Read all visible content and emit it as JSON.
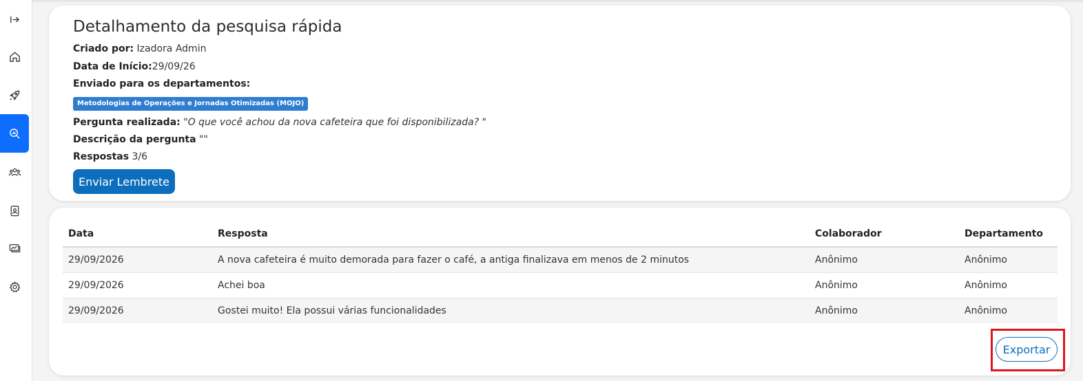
{
  "sidebar": {
    "items": [
      {
        "icon": "expand-icon"
      },
      {
        "icon": "home-icon"
      },
      {
        "icon": "rocket-icon"
      },
      {
        "icon": "search-analytics-icon",
        "active": true
      },
      {
        "icon": "team-icon"
      },
      {
        "icon": "badge-icon"
      },
      {
        "icon": "chart-card-icon"
      },
      {
        "icon": "gear-icon"
      }
    ],
    "active_color": "#0d6efd"
  },
  "detail": {
    "title": "Detalhamento da pesquisa rápida",
    "created_by_label": "Criado por:",
    "created_by_value": " Izadora Admin",
    "start_date_label": "Data de Início:",
    "start_date_value": "29/09/26",
    "departments_label": "Enviado para os departamentos:",
    "department_badge": "Metodologias de Operações e Jornadas Otimizadas (MOJO)",
    "question_label": "Pergunta realizada:",
    "question_value": " \"O que você achou da nova cafeteira que foi disponibilizada? \"",
    "description_label": "Descrição da pergunta",
    "description_value": " \"\"",
    "responses_label": "Respostas",
    "responses_value": " 3/6",
    "reminder_button": "Enviar Lembrete"
  },
  "table": {
    "headers": [
      "Data",
      "Resposta",
      "Colaborador",
      "Departamento"
    ],
    "rows": [
      [
        "29/09/2026",
        "A nova cafeteira é muito demorada para fazer o café, a antiga finalizava em menos de 2 minutos",
        "Anônimo",
        "Anônimo"
      ],
      [
        "29/09/2026",
        "Achei boa",
        "Anônimo",
        "Anônimo"
      ],
      [
        "29/09/2026",
        "Gostei muito! Ela possui várias funcionalidades",
        "Anônimo",
        "Anônimo"
      ]
    ]
  },
  "export_button": "Exportar",
  "colors": {
    "primary": "#0d6ebd",
    "badge": "#2f7dd1",
    "highlight": "#e0141e"
  }
}
